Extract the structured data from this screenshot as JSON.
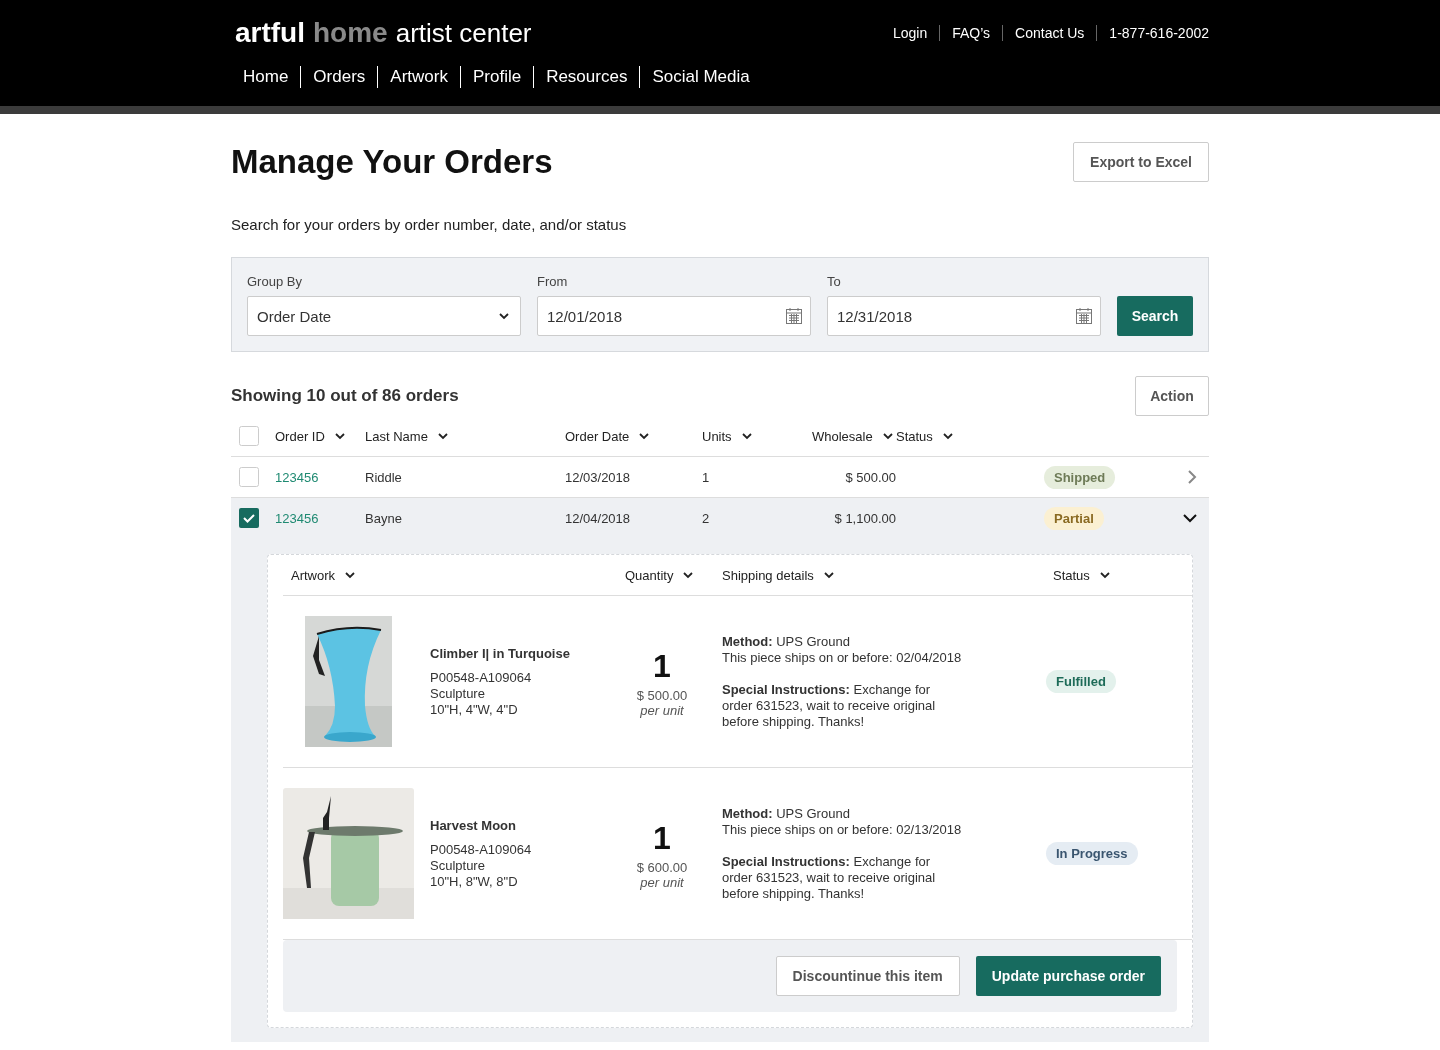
{
  "header": {
    "logo": {
      "part_1": "artful",
      "part_2": "home",
      "part_3": "artist center"
    },
    "utility_links": [
      "Login",
      "FAQ’s",
      "Contact Us",
      "1-877-616-2002"
    ],
    "nav": [
      "Home",
      "Orders",
      "Artwork",
      "Profile",
      "Resources",
      "Social Media"
    ]
  },
  "page": {
    "title": "Manage Your Orders",
    "export_button": "Export to Excel",
    "subtitle": "Search for your orders by order number, date, and/or status"
  },
  "filters": {
    "group_by": {
      "label": "Group By",
      "value": "Order Date"
    },
    "from": {
      "label": "From",
      "value": "12/01/2018"
    },
    "to": {
      "label": "To",
      "value": "12/31/2018"
    },
    "search_button": "Search"
  },
  "results": {
    "summary": "Showing 10 out of 86 orders",
    "action_button": "Action",
    "select_all": {
      "checked": false
    },
    "columns": [
      "Order ID",
      "Last Name",
      "Order Date",
      "Units",
      "Wholesale",
      "Status"
    ],
    "rows": [
      {
        "checked": false,
        "expanded": false,
        "order_id": "123456",
        "last_name": "Riddle",
        "order_date": "12/03/2018",
        "units": "1",
        "wholesale": "$ 500.00",
        "status": {
          "label": "Shipped",
          "kind": "shipped"
        }
      },
      {
        "checked": true,
        "expanded": true,
        "order_id": "123456",
        "last_name": "Bayne",
        "order_date": "12/04/2018",
        "units": "2",
        "wholesale": "$ 1,100.00",
        "status": {
          "label": "Partial",
          "kind": "partial"
        },
        "detail": {
          "columns": [
            "Artwork",
            "Quantity",
            "Shipping details",
            "Status"
          ],
          "items": [
            {
              "kind": "picture",
              "title": "Climber I| in Turquoise",
              "sku": "P00548-A109064",
              "type": "Sculpture",
              "dimensions": "10\"H, 4\"W, 4\"D",
              "quantity": "1",
              "price": "$ 500.00",
              "price_note": "per unit",
              "method": "**Method:** UPS Ground",
              "ships": "This piece ships on or before: 02/04/2018",
              "instructions": "**Special Instructions:** Exchange for order 631523, wait to receive original before shipping. Thanks!",
              "status": {
                "label": "Fulfilled",
                "kind": "fulfilled"
              }
            },
            {
              "kind": "picture",
              "title": "Harvest Moon",
              "sku": "P00548-A109064",
              "type": "Sculpture",
              "dimensions": "10\"H, 8\"W, 8\"D",
              "quantity": "1",
              "price": "$ 600.00",
              "price_note": "per unit",
              "method": "**Method:** UPS Ground",
              "ships": "This piece ships on or before: 02/13/2018",
              "instructions": "**Special Instructions:** Exchange for order 631523, wait to receive original before shipping. Thanks!",
              "status": {
                "label": "In Progress",
                "kind": "in_progress"
              }
            }
          ],
          "buttons": {
            "discontinue": "Discountinue this item",
            "update": "Update purchase order"
          }
        }
      }
    ]
  }
}
